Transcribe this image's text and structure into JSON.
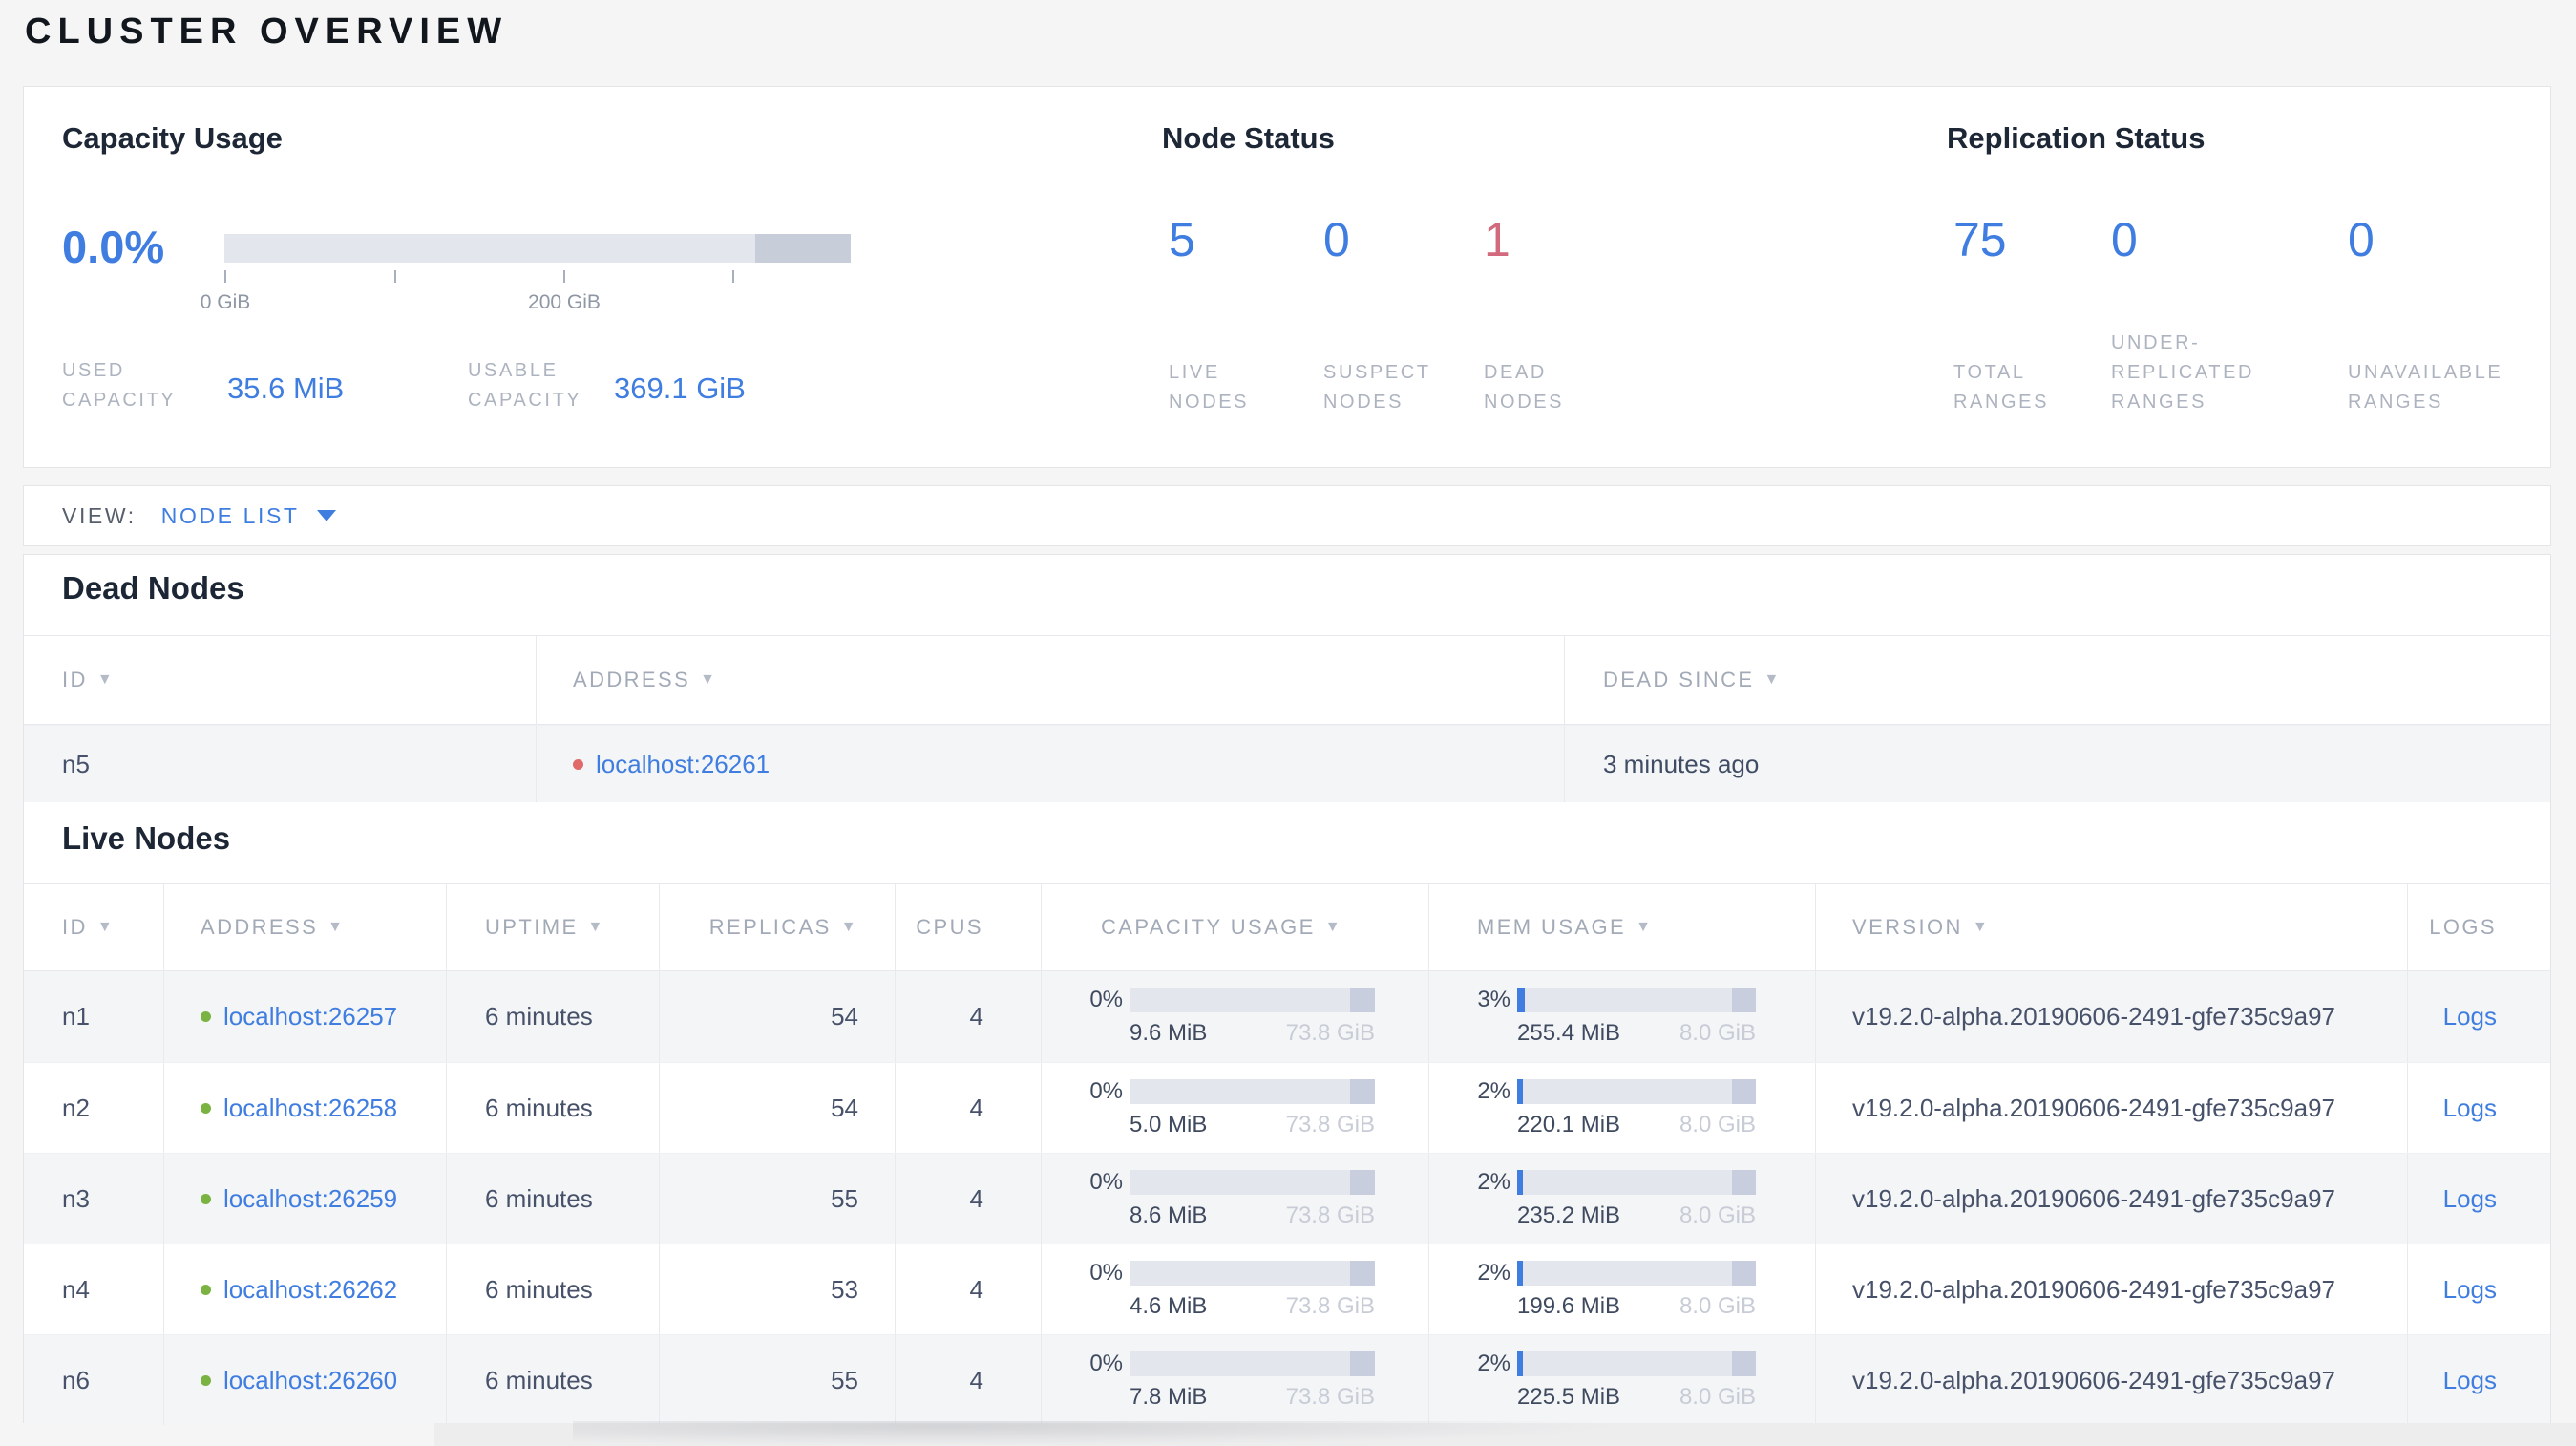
{
  "page_title": "CLUSTER OVERVIEW",
  "summary": {
    "capacity": {
      "title": "Capacity Usage",
      "percent": "0.0%",
      "bar": {
        "used_fill_pct": 0,
        "reserved_width_pct": 15.2
      },
      "axis_ticks": [
        {
          "pos_pct": 0,
          "label": "0 GiB"
        },
        {
          "pos_pct": 27.1,
          "label": ""
        },
        {
          "pos_pct": 54.1,
          "label": "200 GiB"
        },
        {
          "pos_pct": 81.1,
          "label": ""
        }
      ],
      "used": {
        "label": "USED\nCAPACITY",
        "value": "35.6 MiB"
      },
      "usable": {
        "label": "USABLE\nCAPACITY",
        "value": "369.1 GiB"
      }
    },
    "node_status": {
      "title": "Node Status",
      "stats": [
        {
          "value": "5",
          "label": "LIVE\nNODES",
          "status": "live"
        },
        {
          "value": "0",
          "label": "SUSPECT\nNODES",
          "status": "suspect"
        },
        {
          "value": "1",
          "label": "DEAD\nNODES",
          "status": "dead"
        }
      ]
    },
    "replication": {
      "title": "Replication Status",
      "stats": [
        {
          "value": "75",
          "label": "TOTAL\nRANGES"
        },
        {
          "value": "0",
          "label": "UNDER-\nREPLICATED\nRANGES"
        },
        {
          "value": "0",
          "label": "UNAVAILABLE\nRANGES"
        }
      ]
    }
  },
  "view_bar": {
    "label": "VIEW:",
    "selected": "NODE LIST"
  },
  "dead_section": {
    "heading": "Dead Nodes",
    "columns": [
      {
        "label": "ID",
        "arrow": "▼"
      },
      {
        "label": "ADDRESS",
        "arrow": "▼"
      },
      {
        "label": "DEAD SINCE",
        "arrow": "▼"
      }
    ],
    "rows": [
      {
        "id": "n5",
        "address": "localhost:26261",
        "status": "dead",
        "dead_since": "3 minutes ago"
      }
    ]
  },
  "live_section": {
    "heading": "Live Nodes",
    "columns": [
      {
        "label": "ID",
        "arrow": "▼"
      },
      {
        "label": "ADDRESS",
        "arrow": "▼"
      },
      {
        "label": "UPTIME",
        "arrow": "▼"
      },
      {
        "label": "REPLICAS",
        "arrow": "▼"
      },
      {
        "label": "CPUS",
        "arrow": ""
      },
      {
        "label": "CAPACITY USAGE",
        "arrow": "▼"
      },
      {
        "label": "MEM USAGE",
        "arrow": "▼"
      },
      {
        "label": "VERSION",
        "arrow": "▼"
      },
      {
        "label": "LOGS",
        "arrow": ""
      }
    ],
    "rows": [
      {
        "id": "n1",
        "address": "localhost:26257",
        "status": "live",
        "uptime": "6 minutes",
        "replicas": "54",
        "cpus": "4",
        "capacity": {
          "percent": "0%",
          "fill_pct": 0,
          "used": "9.6 MiB",
          "total": "73.8 GiB"
        },
        "memory": {
          "percent": "3%",
          "fill_pct": 3,
          "used": "255.4 MiB",
          "total": "8.0 GiB"
        },
        "version": "v19.2.0-alpha.20190606-2491-gfe735c9a97",
        "logs_label": "Logs"
      },
      {
        "id": "n2",
        "address": "localhost:26258",
        "status": "live",
        "uptime": "6 minutes",
        "replicas": "54",
        "cpus": "4",
        "capacity": {
          "percent": "0%",
          "fill_pct": 0,
          "used": "5.0 MiB",
          "total": "73.8 GiB"
        },
        "memory": {
          "percent": "2%",
          "fill_pct": 2.5,
          "used": "220.1 MiB",
          "total": "8.0 GiB"
        },
        "version": "v19.2.0-alpha.20190606-2491-gfe735c9a97",
        "logs_label": "Logs"
      },
      {
        "id": "n3",
        "address": "localhost:26259",
        "status": "live",
        "uptime": "6 minutes",
        "replicas": "55",
        "cpus": "4",
        "capacity": {
          "percent": "0%",
          "fill_pct": 0,
          "used": "8.6 MiB",
          "total": "73.8 GiB"
        },
        "memory": {
          "percent": "2%",
          "fill_pct": 2.5,
          "used": "235.2 MiB",
          "total": "8.0 GiB"
        },
        "version": "v19.2.0-alpha.20190606-2491-gfe735c9a97",
        "logs_label": "Logs"
      },
      {
        "id": "n4",
        "address": "localhost:26262",
        "status": "live",
        "uptime": "6 minutes",
        "replicas": "53",
        "cpus": "4",
        "capacity": {
          "percent": "0%",
          "fill_pct": 0,
          "used": "4.6 MiB",
          "total": "73.8 GiB"
        },
        "memory": {
          "percent": "2%",
          "fill_pct": 2.5,
          "used": "199.6 MiB",
          "total": "8.0 GiB"
        },
        "version": "v19.2.0-alpha.20190606-2491-gfe735c9a97",
        "logs_label": "Logs"
      },
      {
        "id": "n6",
        "address": "localhost:26260",
        "status": "live",
        "uptime": "6 minutes",
        "replicas": "55",
        "cpus": "4",
        "capacity": {
          "percent": "0%",
          "fill_pct": 0,
          "used": "7.8 MiB",
          "total": "73.8 GiB"
        },
        "memory": {
          "percent": "2%",
          "fill_pct": 2.5,
          "used": "225.5 MiB",
          "total": "8.0 GiB"
        },
        "version": "v19.2.0-alpha.20190606-2491-gfe735c9a97",
        "logs_label": "Logs"
      }
    ]
  },
  "colors": {
    "accent_blue": "#3f7de0",
    "danger_red": "#d2697c",
    "live_green": "#7bb342",
    "dead_dot_red": "#e06a6a"
  }
}
